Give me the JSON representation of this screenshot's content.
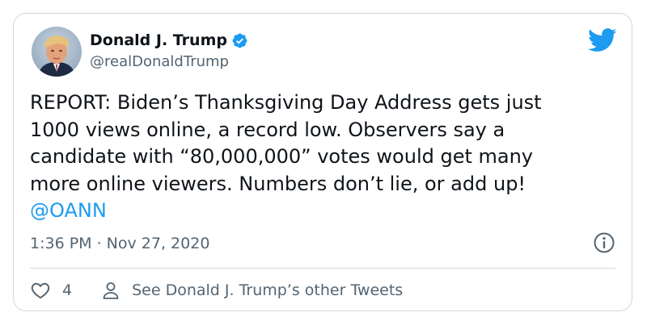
{
  "user": {
    "name": "Donald J. Trump",
    "handle": "@realDonaldTrump"
  },
  "tweet": {
    "text": "REPORT: Biden’s Thanksgiving Day Address gets just\n1000 views online, a record low. Observers say a\ncandidate with “80,000,000” votes would get many\nmore online viewers. Numbers don’t lie, or add up!",
    "mention": "@OANN",
    "timestamp": "1:36 PM · Nov 27, 2020"
  },
  "actions": {
    "like_count": "4",
    "other_tweets_label": "See Donald J. Trump’s other Tweets"
  },
  "icons": {
    "brand": "twitter-bird-icon",
    "verified": "verified-badge-icon",
    "info": "info-icon",
    "like": "heart-icon",
    "profile": "person-icon"
  },
  "colors": {
    "accent": "#1d9bf0",
    "text": "#0f1419",
    "secondary_text": "#536471",
    "border": "#cfd9de"
  }
}
